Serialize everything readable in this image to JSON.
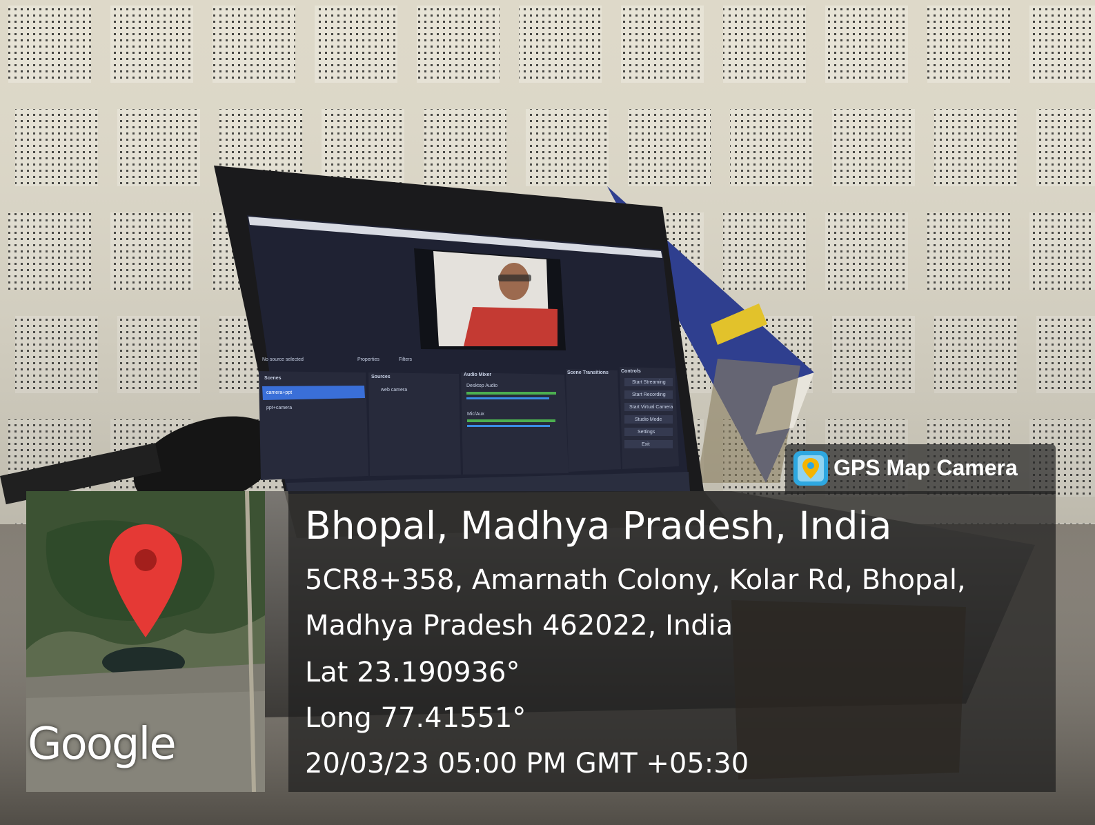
{
  "gps_overlay": {
    "app_name": "GPS Map Camera",
    "location_title": "Bhopal, Madhya Pradesh, India",
    "address_line1": "5CR8+358, Amarnath Colony, Kolar Rd, Bhopal,",
    "address_line2": "Madhya Pradesh 462022, India",
    "latitude": "Lat 23.190936°",
    "longitude": "Long 77.41551°",
    "timestamp": "20/03/23 05:00 PM GMT +05:30"
  },
  "map": {
    "attribution": "Google",
    "pin_color": "#e53935"
  },
  "screen": {
    "status_text": "No source selected",
    "properties_label": "Properties",
    "filters_label": "Filters",
    "scenes_header": "Scenes",
    "scenes": [
      "camera+ppt",
      "ppt+camera"
    ],
    "sources_header": "Sources",
    "sources": [
      "web camera"
    ],
    "audio_mixer_header": "Audio Mixer",
    "audio_channels": [
      "Desktop Audio",
      "Mic/Aux"
    ],
    "transitions_header": "Scene Transitions",
    "controls_header": "Controls",
    "controls": [
      "Start Streaming",
      "Start Recording",
      "Start Virtual Camera",
      "Studio Mode",
      "Settings",
      "Exit"
    ]
  },
  "colors": {
    "obs_bg": "#1f2233",
    "obs_panel": "#272a3b",
    "selection": "#3a6fd8",
    "overlay_bg": "#1e1e1e"
  }
}
